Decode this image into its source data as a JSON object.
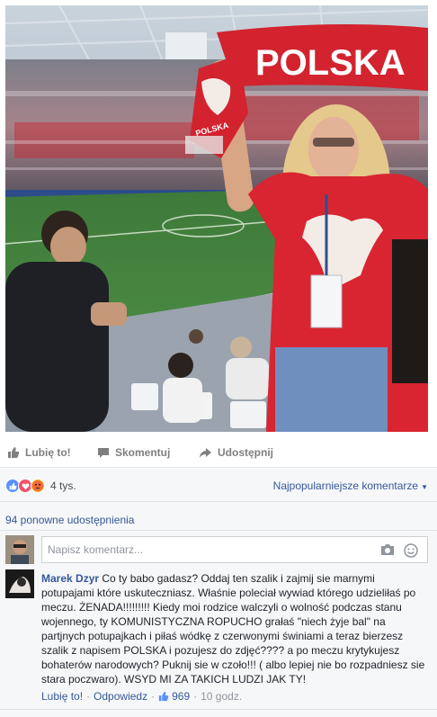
{
  "photo": {
    "scarf_text": "POLSKA",
    "scarf_small_text": "POLSKA"
  },
  "actions": {
    "like": "Lubię to!",
    "comment": "Skomentuj",
    "share": "Udostępnij"
  },
  "reactions": {
    "count": "4 tys.",
    "sort_label": "Najpopularniejsze komentarze"
  },
  "shares": {
    "label": "94 ponowne udostępnienia"
  },
  "composer": {
    "placeholder": "Napisz komentarz..."
  },
  "comment": {
    "author": "Marek Dzyr",
    "text": "Co ty babo gadasz? Oddaj ten szalik i zajmij sie marnymi potupajami które uskuteczniasz. Właśnie poleciał wywiad którego udzieliłaś po meczu. ŻENADA!!!!!!!!! Kiedy moi rodzice walczyli o wolność podczas stanu wojennego, ty KOMUNISTYCZNA ROPUCHO grałaś \"niech żyje bal\" na partjnych potupajkach i piłaś wódkę z czerwonymi świniami a teraz bierzesz szalik z napisem POLSKA i pozujesz do zdjęć???? a po meczu krytykujesz bohaterów narodowych? Puknij sie w czoło!!! ( albo lepiej nie bo rozpadniesz sie stara poczwaro). WSYD MI ZA TAKICH LUDZI JAK TY!",
    "like_link": "Lubię to!",
    "reply_link": "Odpowiedz",
    "like_count": "969",
    "time": "10 godz."
  },
  "colors": {
    "link": "#365899",
    "like_blue": "#5890ff",
    "love_red": "#f25268",
    "angry_orange": "#f7b125"
  }
}
